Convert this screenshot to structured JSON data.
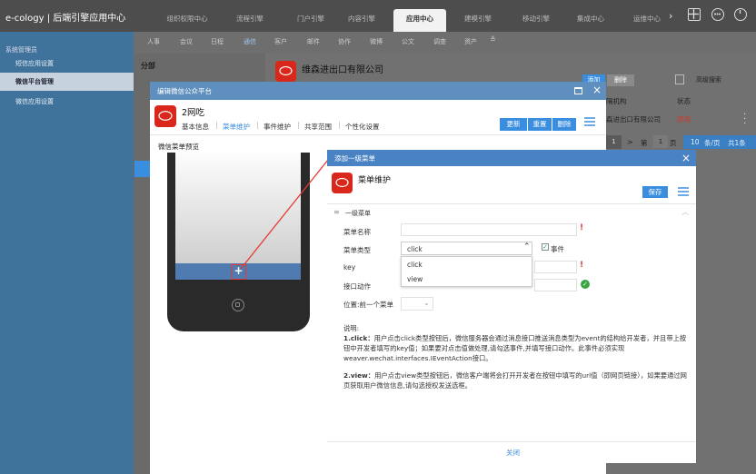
{
  "topbar": {
    "brand": "e-cology | 后端引擎应用中心",
    "tabs": [
      "组织权限中心",
      "流程引擎",
      "门户引擎",
      "内容引擎",
      "应用中心",
      "建模引擎",
      "移动引擎",
      "集成中心",
      "运维中心"
    ],
    "active_tab": "应用中心"
  },
  "sidebar": {
    "title": "系统管理员",
    "items": [
      "短信应用设置",
      "微信平台管理",
      "微信应用设置"
    ],
    "active_item": "微信平台管理"
  },
  "subnav": {
    "items": [
      "人事",
      "会议",
      "日程",
      "通信",
      "客户",
      "邮件",
      "协作",
      "微博",
      "公文",
      "调查",
      "资产"
    ],
    "active": "通信"
  },
  "left_panel": {
    "title": "分部"
  },
  "main_panel": {
    "company": "维森进出口有限公司",
    "add_button": "添加",
    "delete_button": "删除",
    "search_button": "高级搜索",
    "col_org": "隔机构",
    "col_status": "状态",
    "row_org": "森进出口有限公司",
    "row_status": "禁用",
    "pager": {
      "first": "1",
      "next": ">",
      "jump": "第",
      "page": "1",
      "page_unit": "页",
      "per_page": "10",
      "per_page_unit": "条/页",
      "total": "共1条"
    }
  },
  "dialog1": {
    "title": "编辑微信公众平台",
    "account": "2网吃",
    "tabs": [
      "基本信息",
      "菜单维护",
      "事件维护",
      "共享范围",
      "个性化设置"
    ],
    "active_tab": "菜单维护",
    "buttons": {
      "update": "更新",
      "reset": "重置",
      "delete": "删除"
    },
    "preview_title": "微信菜单预览",
    "plus": "+"
  },
  "dialog2": {
    "title": "添加一级菜单",
    "heading": "菜单维护",
    "save": "保存",
    "section": "一级菜单",
    "fields": {
      "name_label": "菜单名称",
      "type_label": "菜单类型",
      "type_value": "click",
      "event_label": "事件",
      "key_label": "key",
      "action_label": "接口动作",
      "position_label": "位置:前一个菜单"
    },
    "dropdown_options": [
      "click",
      "view"
    ],
    "desc_title": "说明:",
    "desc_click_head": "1.click：",
    "desc_click_body": "用户点击click类型按钮后，微信服务器会通过消息接口推送消息类型为event的结构给开发者，并且带上按钮中开发者填写的key值；如果要对点击值做处理,请勾选事件,并填写接口动作。此事件必须实现weaver.wechat.interfaces.IEventAction接口。",
    "desc_view_head": "2.view：",
    "desc_view_body": "用户点击view类型按钮后，微信客户端将会打开开发者在按钮中填写的url值（即网页链接），如果要通过网页获取用户微信信息,请勾选授权发送选框。",
    "close": "关闭"
  }
}
